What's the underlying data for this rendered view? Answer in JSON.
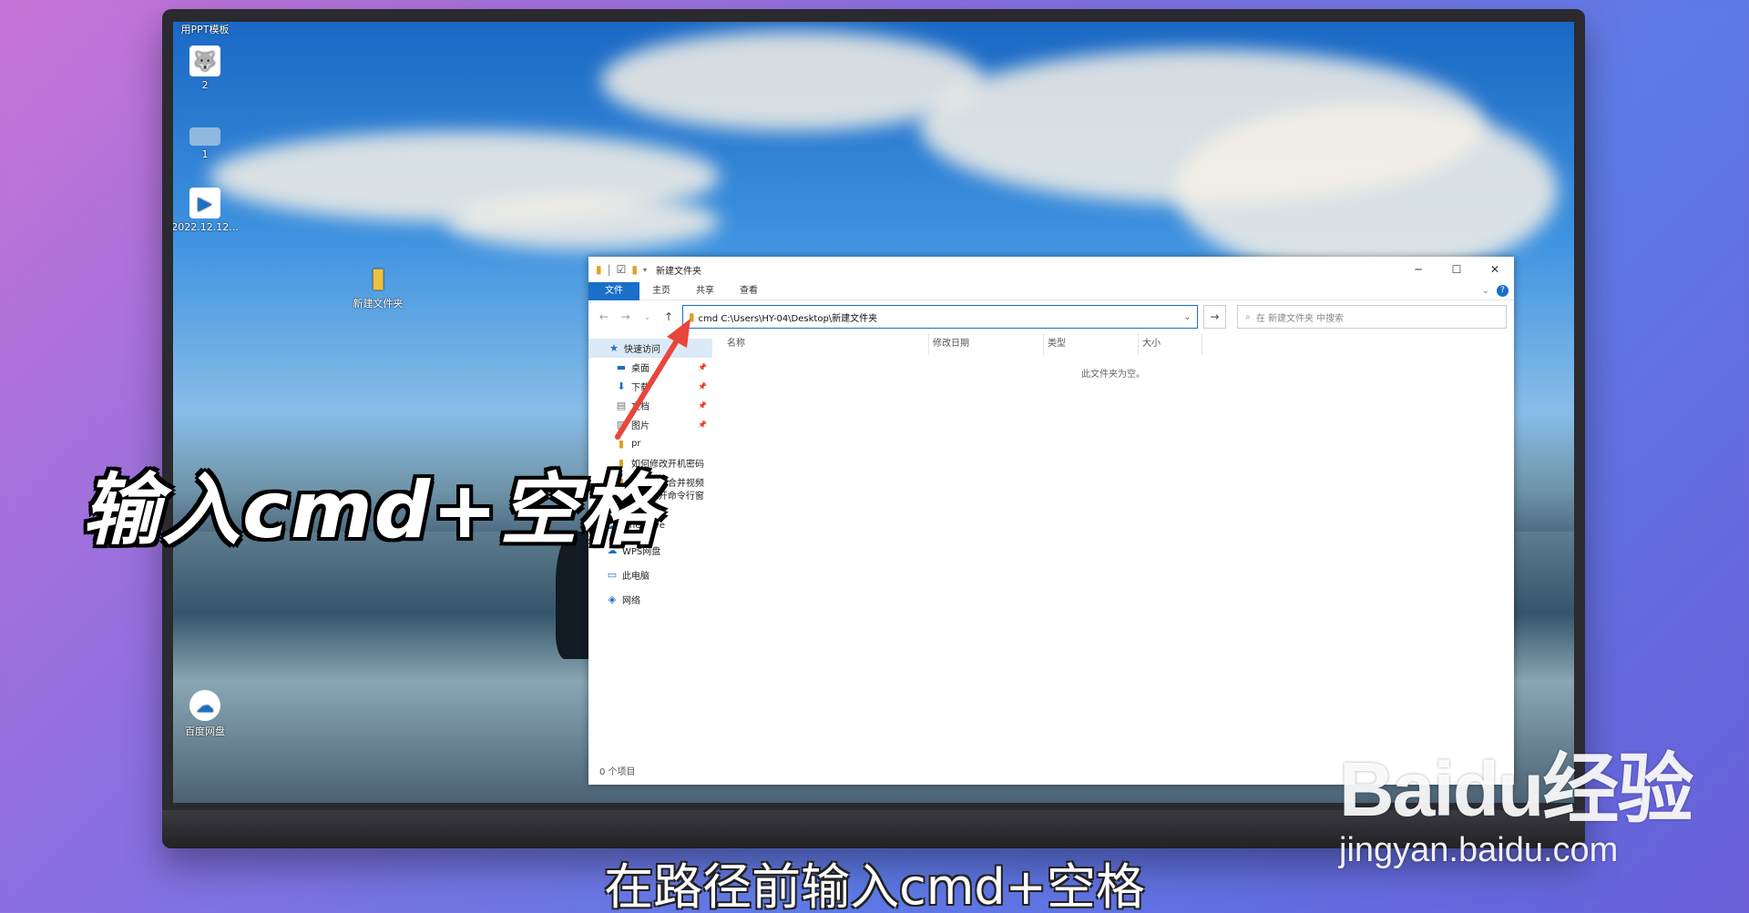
{
  "desktop": {
    "top_label": "用PPT模板",
    "icons": [
      {
        "label": "2"
      },
      {
        "label": "1"
      },
      {
        "label": "2022.12.12..."
      },
      {
        "label": "新建文件夹"
      },
      {
        "label": "百度网盘"
      }
    ]
  },
  "explorer": {
    "title": "新建文件夹",
    "window_buttons": {
      "minimize": "─",
      "maximize": "☐",
      "close": "✕"
    },
    "ribbon_tabs": [
      "文件",
      "主页",
      "共享",
      "查看"
    ],
    "address_value": "cmd C:\\Users\\HY-04\\Desktop\\新建文件夹",
    "search_placeholder": "在 新建文件夹 中搜索",
    "nav_items": [
      {
        "label": "快速访问"
      },
      {
        "label": "桌面"
      },
      {
        "label": "下载"
      },
      {
        "label": "文档"
      },
      {
        "label": "图片"
      },
      {
        "label": "pr"
      },
      {
        "label": "如何修改开机密码"
      },
      {
        "label": "手机怎么合并视频"
      },
      {
        "label": "怎么打开命令行窗口"
      },
      {
        "label": "OneDrive"
      },
      {
        "label": "WPS网盘"
      },
      {
        "label": "此电脑"
      },
      {
        "label": "网络"
      }
    ],
    "columns": [
      "名称",
      "修改日期",
      "类型",
      "大小"
    ],
    "empty_message": "此文件夹为空。",
    "status": "0 个项目"
  },
  "overlay": {
    "big_caption": "输入cmd+空格",
    "subtitle": "在路径前输入cmd+空格",
    "watermark_logo": "Baidu经验",
    "watermark_domain": "jingyan.baidu.com"
  },
  "colors": {
    "accent": "#1a6fc9",
    "arrow": "#e8453c",
    "folder": "#d9a320"
  }
}
